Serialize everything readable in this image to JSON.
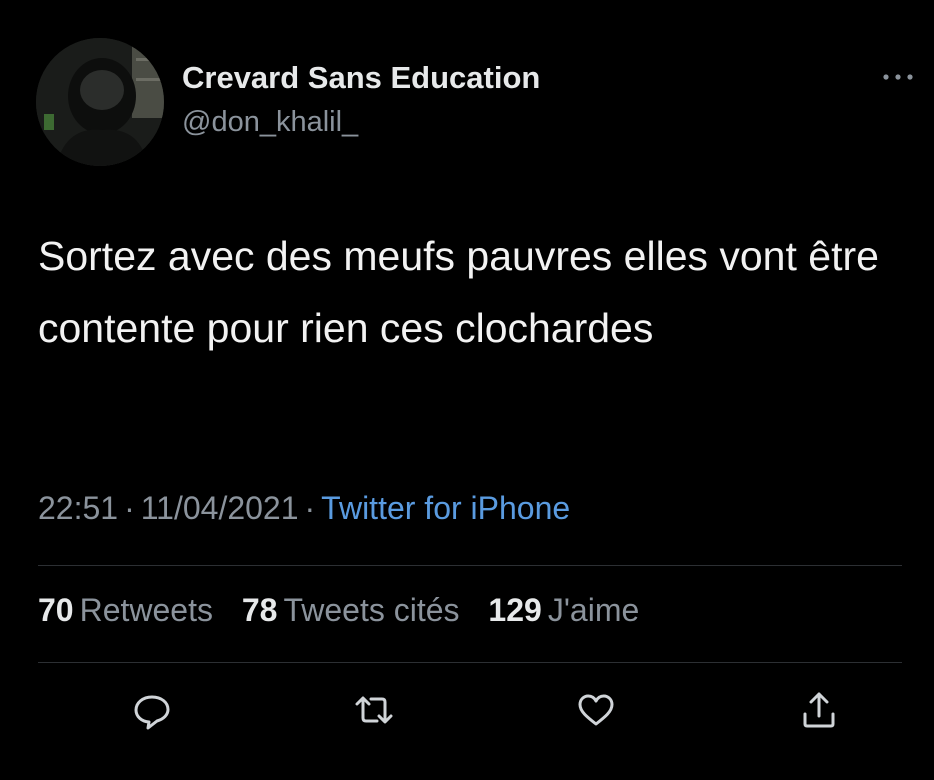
{
  "tweet": {
    "author": {
      "display_name": "Crevard Sans Education",
      "handle": "@don_khalil_",
      "avatar_icon": "avatar-photo-icon"
    },
    "text": "Sortez avec des meufs pauvres elles vont être contente pour rien ces clochardes",
    "time": "22:51",
    "date": "11/04/2021",
    "separator": "·",
    "source": "Twitter for iPhone",
    "stats": [
      {
        "count": "70",
        "label": "Retweets"
      },
      {
        "count": "78",
        "label": "Tweets cités"
      },
      {
        "count": "129",
        "label": "J'aime"
      }
    ],
    "actions": [
      {
        "icon": "reply-icon"
      },
      {
        "icon": "retweet-icon"
      },
      {
        "icon": "like-icon"
      },
      {
        "icon": "share-icon"
      }
    ],
    "more_icon": "more-options-icon"
  },
  "colors": {
    "background": "#000000",
    "text": "#e7e9ea",
    "secondary_text": "#8b939c",
    "link": "#5a9be0",
    "divider": "#2c2f33"
  }
}
